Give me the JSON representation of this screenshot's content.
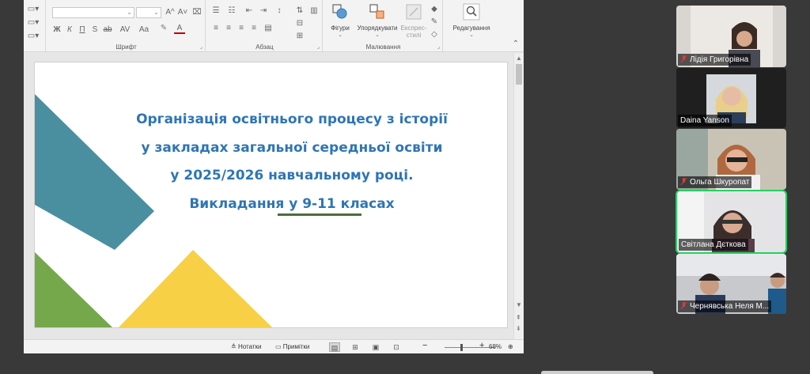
{
  "ribbon": {
    "groups": {
      "font": "Шрифт",
      "paragraph": "Абзац",
      "drawing": "Малювання",
      "editing": "Редагування"
    },
    "font_buttons": [
      "Ж",
      "К",
      "П",
      "S",
      "ab",
      "AV",
      "Aa",
      "A"
    ],
    "font_size_controls": [
      "A^",
      "A˅"
    ],
    "drawing_buttons": {
      "shapes": "Фігури",
      "arrange": "Упорядкувати",
      "quick_styles_line1": "Експрес-",
      "quick_styles_line2": "стилі"
    },
    "editing_button": "Редагування"
  },
  "slide": {
    "title_lines": [
      "Організація освітнього процесу з історії",
      "у закладах загальної середньої освіти",
      "у 2025/2026 навчальному році.",
      "Викладання у 9-11 класах"
    ],
    "colors": {
      "title": "#2e75b6",
      "teal": "#4a8fa0",
      "green": "#74a84a",
      "yellow": "#f7d046",
      "underline": "#4b6d3c"
    }
  },
  "statusbar": {
    "notes": "Нотатки",
    "comments": "Примітки",
    "zoom": "68%",
    "zoom_minus": "−",
    "zoom_plus": "+"
  },
  "participants": [
    {
      "name": "Лідія Григорівна",
      "muted": true
    },
    {
      "name": "Daina Yanson",
      "muted": false
    },
    {
      "name": "Ольга Шкуропат",
      "muted": true
    },
    {
      "name": "Світлана Дєткова",
      "muted": false,
      "speaking": true
    },
    {
      "name": "Чернявська Неля М...",
      "muted": true
    }
  ]
}
